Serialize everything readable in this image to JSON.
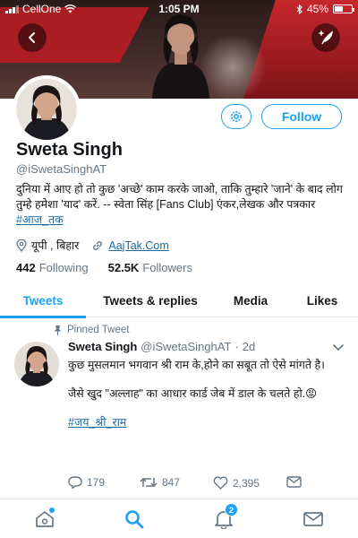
{
  "status_bar": {
    "carrier": "CellOne",
    "time": "1:05 PM",
    "battery": "45%"
  },
  "profile": {
    "name": "Sweta Singh",
    "handle": "@iSwetaSinghAT",
    "bio_text": "दुनिया में आए हो तो कुछ 'अच्छे' काम करके जाओ, ताकि तुम्हारे 'जाने' के बाद लोग तुम्हे हमेशा 'याद' करें. -- स्वेता सिंह [Fans Club] एंकर,लेखक और पत्रकार",
    "bio_hashtag": "#आज_तक",
    "location": "यूपी , बिहार",
    "website": "AajTak.Com",
    "following_count": "442",
    "following_label": "Following",
    "followers_count": "52.5K",
    "followers_label": "Followers",
    "follow_button": "Follow"
  },
  "tabs": [
    {
      "label": "Tweets",
      "active": true
    },
    {
      "label": "Tweets & replies",
      "active": false
    },
    {
      "label": "Media",
      "active": false
    },
    {
      "label": "Likes",
      "active": false
    }
  ],
  "tweet": {
    "pinned_label": "Pinned Tweet",
    "author_name": "Sweta Singh",
    "author_handle": "@iSwetaSinghAT",
    "separator": "·",
    "age": "2d",
    "paragraph1": "कुछ मुसलमान भगवान श्री राम के,होने का सबूत तो ऐसे मांगते है।",
    "paragraph2": "जैसे खुद \"अल्लाह\" का आधार कार्ड जेब में डाल के चलते हो.😡",
    "hashtag": "#जय_श्री_राम",
    "replies": "179",
    "retweets": "847",
    "likes": "2,395"
  },
  "bottom_nav": {
    "notification_badge": "2"
  },
  "colors": {
    "accent": "#1da1f2",
    "link": "#1b6aa5",
    "secondary_text": "#657786"
  },
  "icons": {
    "back": "back-arrow-icon",
    "compose": "compose-feather-icon",
    "settings": "gear-icon",
    "location": "location-pin-icon",
    "link": "link-icon",
    "pin": "pin-icon",
    "chevron": "chevron-down-icon",
    "reply": "reply-icon",
    "retweet": "retweet-icon",
    "like": "heart-icon",
    "share": "share-icon",
    "home": "home-icon",
    "search": "search-icon",
    "notifications": "bell-icon",
    "messages": "mail-icon"
  }
}
